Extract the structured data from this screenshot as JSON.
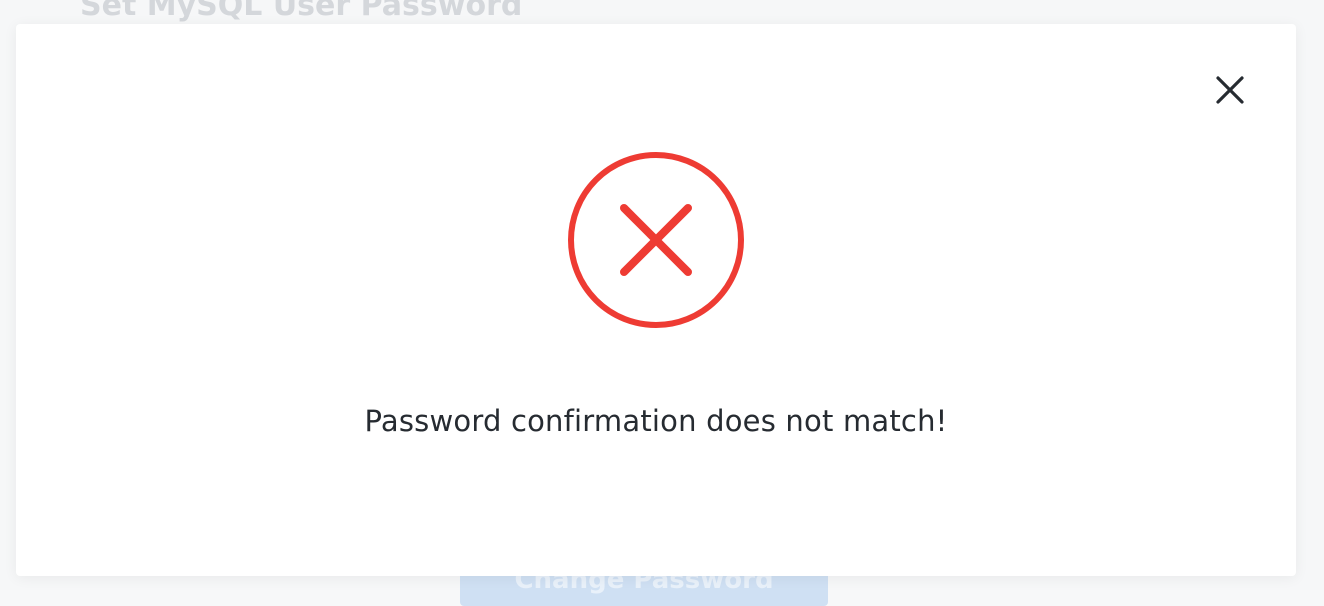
{
  "background": {
    "page_title": "Set MySQL User Password",
    "submit_button_label": "Change Password"
  },
  "modal": {
    "icon": "error-x-circle-icon",
    "message": "Password confirmation does not match!",
    "close_icon": "close-icon"
  },
  "colors": {
    "error": "#ee3b33",
    "text": "#262b31",
    "close_icon": "#262b31"
  }
}
